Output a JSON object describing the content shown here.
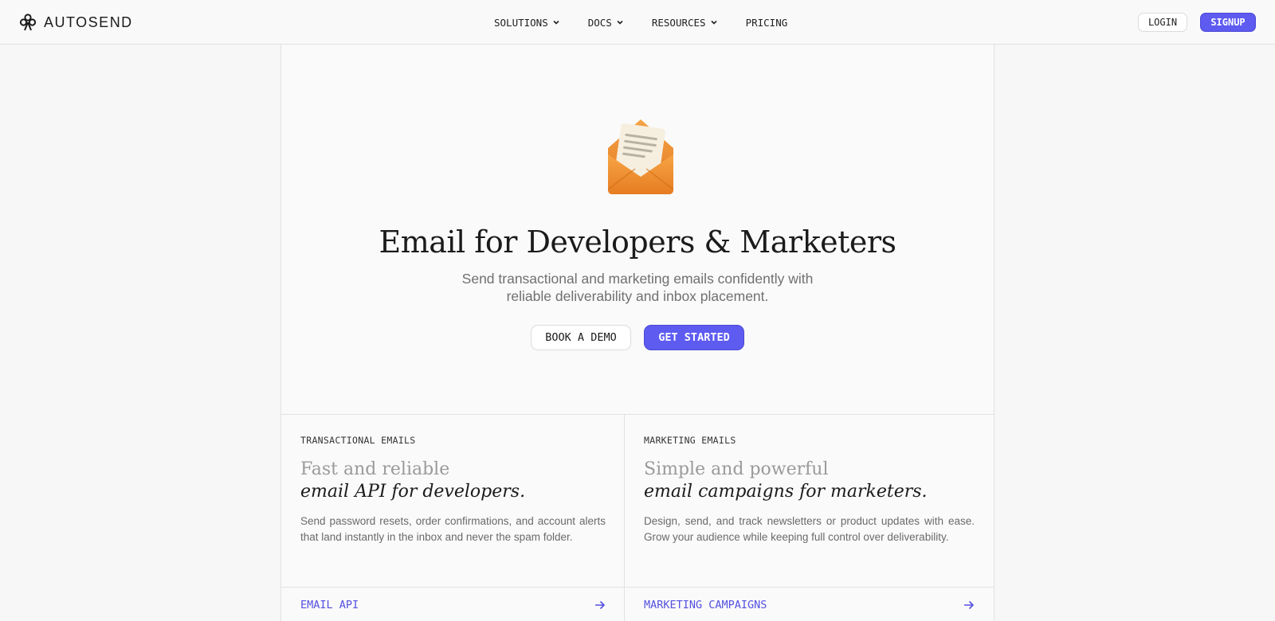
{
  "header": {
    "brand": "AUTOSEND",
    "nav": [
      {
        "label": "SOLUTIONS",
        "dropdown": true
      },
      {
        "label": "DOCS",
        "dropdown": true
      },
      {
        "label": "RESOURCES",
        "dropdown": true
      },
      {
        "label": "PRICING",
        "dropdown": false
      }
    ],
    "login_label": "LOGIN",
    "signup_label": "SIGNUP"
  },
  "hero": {
    "icon": "envelope-with-letter-icon",
    "title": "Email for Developers & Marketers",
    "subtitle_line1": "Send transactional and marketing emails confidently with",
    "subtitle_line2": "reliable deliverability and inbox placement.",
    "demo_label": "BOOK A DEMO",
    "start_label": "GET STARTED"
  },
  "cards": [
    {
      "label": "TRANSACTIONAL EMAILS",
      "heading_light": "Fast and reliable",
      "heading_dark": "email API for developers.",
      "description": "Send password resets, order confirmations, and account alerts that land instantly in the inbox and never the spam folder.",
      "link": "EMAIL API"
    },
    {
      "label": "MARKETING EMAILS",
      "heading_light": "Simple and powerful",
      "heading_dark": "email campaigns for marketers.",
      "description": "Design, send, and track newsletters or product updates with ease. Grow your audience while keeping full control over deliverability.",
      "link": "MARKETING CAMPAIGNS"
    }
  ],
  "colors": {
    "accent": "#5d5bf0",
    "link": "#5450e0",
    "envelope": "#f0902f"
  }
}
